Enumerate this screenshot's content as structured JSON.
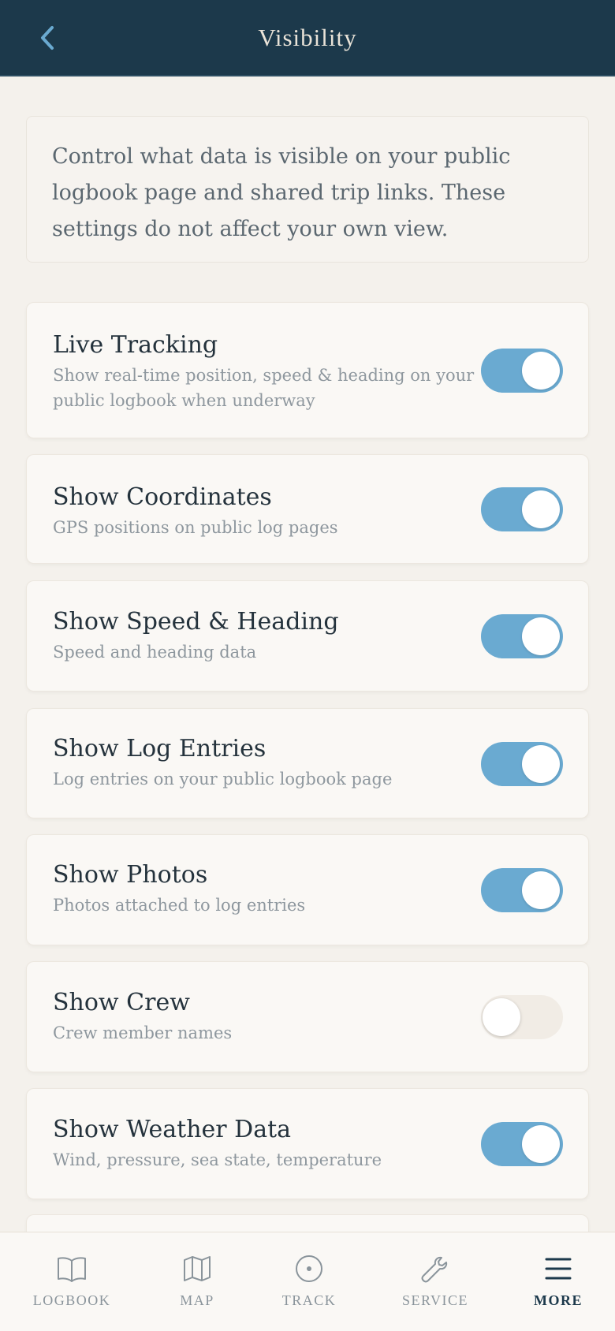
{
  "header": {
    "title": "Visibility",
    "back_icon": "chevron-left-icon"
  },
  "intro": {
    "text": "Control what data is visible on your public logbook page and shared trip links. These settings do not affect your own view."
  },
  "settings": [
    {
      "title": "Live Tracking",
      "description": "Show real-time position, speed & heading on your public logbook when underway",
      "enabled": true
    },
    {
      "title": "Show Coordinates",
      "description": "GPS positions on public log pages",
      "enabled": true
    },
    {
      "title": "Show Speed & Heading",
      "description": "Speed and heading data",
      "enabled": true
    },
    {
      "title": "Show Log Entries",
      "description": "Log entries on your public logbook page",
      "enabled": true
    },
    {
      "title": "Show Photos",
      "description": "Photos attached to log entries",
      "enabled": true
    },
    {
      "title": "Show Crew",
      "description": "Crew member names",
      "enabled": false
    },
    {
      "title": "Show Weather Data",
      "description": "Wind, pressure, sea state, temperature",
      "enabled": true
    }
  ],
  "tabbar": {
    "tabs": [
      {
        "label": "LOGBOOK",
        "icon": "book-icon",
        "active": false
      },
      {
        "label": "MAP",
        "icon": "map-icon",
        "active": false
      },
      {
        "label": "TRACK",
        "icon": "track-icon",
        "active": false
      },
      {
        "label": "SERVICE",
        "icon": "wrench-icon",
        "active": false
      },
      {
        "label": "MORE",
        "icon": "menu-icon",
        "active": true
      }
    ]
  },
  "colors": {
    "header": "#1c394b",
    "accent": "#6aaad1",
    "background": "#f4f1ec"
  }
}
